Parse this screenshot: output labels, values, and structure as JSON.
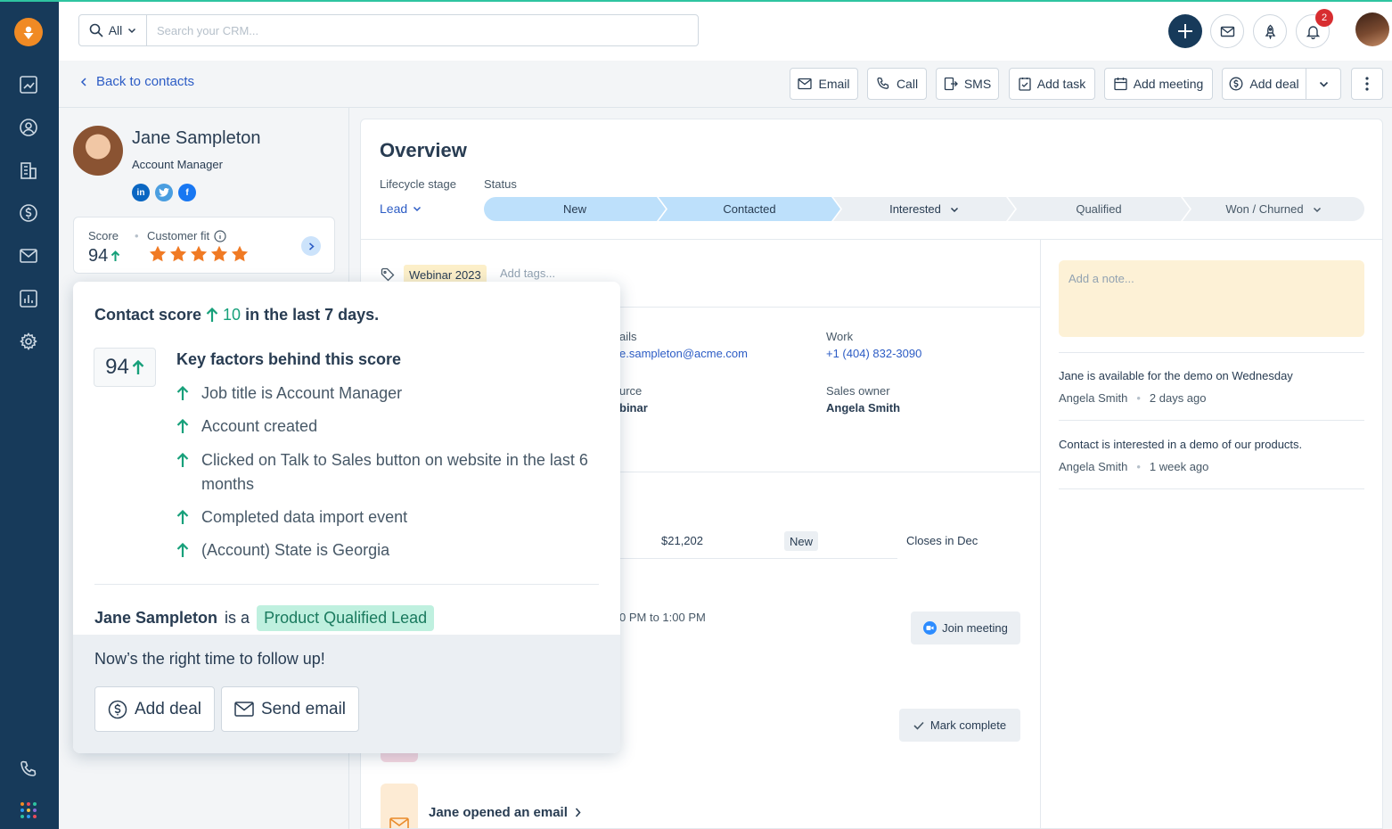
{
  "topbar": {
    "search_scope": "All",
    "search_placeholder": "Search your CRM...",
    "notification_count": "2"
  },
  "actions": {
    "back_label": "Back to contacts",
    "buttons": [
      "Email",
      "Call",
      "SMS",
      "Add task",
      "Add meeting",
      "Add deal"
    ]
  },
  "contact": {
    "name": "Jane Sampleton",
    "title": "Account Manager",
    "score_label": "Score",
    "score": "94",
    "fit_label": "Customer fit",
    "fit_stars": 5
  },
  "overview": {
    "title": "Overview",
    "lifecycle_label": "Lifecycle stage",
    "lifecycle_value": "Lead",
    "status_label": "Status",
    "stages": [
      "New",
      "Contacted",
      "Interested",
      "Qualified",
      "Won / Churned"
    ],
    "tag": "Webinar 2023",
    "add_tags": "Add tags...",
    "emails_label": "ails",
    "email_value": "e.sampleton@acme.com",
    "work_label": "Work",
    "work_value": "+1 (404) 832-3090",
    "source_label": "urce",
    "source_value": "binar",
    "owner_label": "Sales owner",
    "owner_value": "Angela Smith",
    "deal_amount": "$21,202",
    "deal_stage": "New",
    "deal_close": "Closes in Dec",
    "meeting_time": "0 PM to 1:00 PM",
    "join_label": "Join meeting",
    "mark_label": "Mark complete",
    "opened_label": "Jane opened an email"
  },
  "notes": {
    "placeholder": "Add a note...",
    "items": [
      {
        "text": "Jane is available for the demo on Wednesday",
        "author": "Angela Smith",
        "time": "2 days ago"
      },
      {
        "text": "Contact is interested in a demo of our products.",
        "author": "Angela Smith",
        "time": "1 week ago"
      }
    ]
  },
  "popover": {
    "head_prefix": "Contact score",
    "head_delta": "10",
    "head_suffix": "in the last 7 days.",
    "score": "94",
    "factors_title": "Key factors behind this score",
    "factors": [
      "Job title is Account Manager",
      "Account created",
      "Clicked on Talk to Sales button on website in the last 6 months",
      "Completed data import event",
      "(Account) State is Georgia"
    ],
    "pql_name": "Jane Sampleton",
    "pql_is": "is a",
    "pql_badge": "Product Qualified Lead",
    "follow_up": "Now’s the right time to follow up!",
    "add_deal": "Add deal",
    "send_email": "Send email"
  },
  "colors": {
    "rail": "#173a5a",
    "accent": "#2c5cc5",
    "positive": "#17a07a",
    "star": "#f07a24",
    "stage_done": "#bde0fb"
  }
}
